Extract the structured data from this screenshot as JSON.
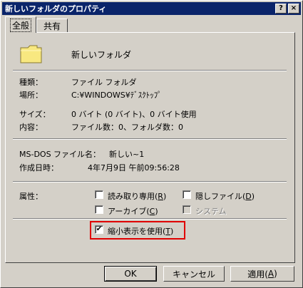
{
  "window": {
    "title": "新しいフォルダのプロパティ",
    "help_button": "?",
    "close_button": "×"
  },
  "tabs": [
    {
      "label": "全般",
      "active": true
    },
    {
      "label": "共有",
      "active": false
    }
  ],
  "general": {
    "folder_icon": "folder-icon",
    "folder_name": "新しいフォルダ",
    "type_label": "種類：",
    "type_value": "ファイル フォルダ",
    "location_label": "場所：",
    "location_value": "C:¥WINDOWS¥ﾃﾞｽｸﾄｯﾌﾟ",
    "size_label": "サイズ：",
    "size_value": "0 バイト (0 バイト)、0 バイト使用",
    "contents_label": "内容：",
    "contents_value": "ファイル数：0、フォルダ数：0",
    "msdos_label": "MS-DOS ファイル名：",
    "msdos_value": "新しい~1",
    "created_label": "作成日時：",
    "created_value": "4年7月9日  午前09:56:28",
    "attributes_label": "属性："
  },
  "attributes": {
    "readonly": {
      "label_pre": "読み取り専用(",
      "key": "R",
      "label_post": ")",
      "checked": false
    },
    "hidden": {
      "label_pre": "隠しファイル(",
      "key": "D",
      "label_post": ")",
      "checked": false
    },
    "archive": {
      "label_pre": "アーカイブ(",
      "key": "C",
      "label_post": ")",
      "checked": false
    },
    "system": {
      "label": "システム",
      "checked": false,
      "disabled": true
    }
  },
  "thumbnail": {
    "label_pre": "縮小表示を使用(",
    "key": "T",
    "label_post": ")",
    "checked": true,
    "check_mark": "✔"
  },
  "buttons": {
    "ok": "OK",
    "cancel": "キャンセル",
    "apply_pre": "適用(",
    "apply_key": "A",
    "apply_post": ")"
  },
  "colors": {
    "titlebar": "#0a246a",
    "highlight_border": "#e00000"
  }
}
